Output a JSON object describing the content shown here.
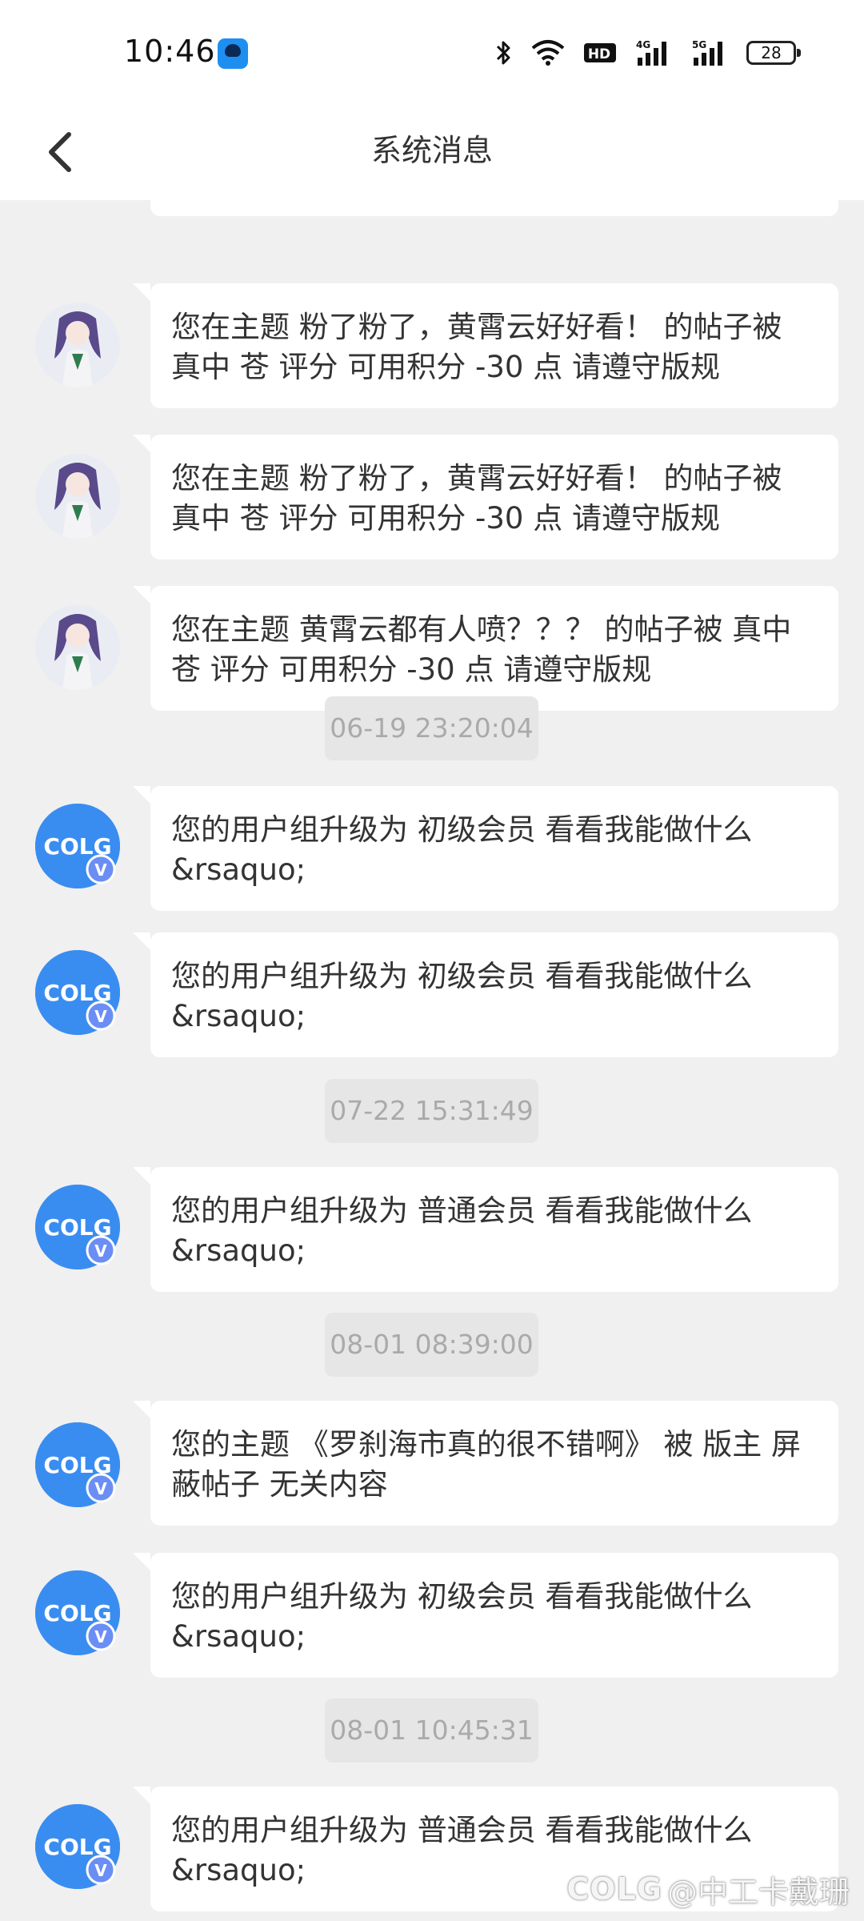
{
  "status_bar": {
    "time": "10:46",
    "battery": "28",
    "icons": [
      "app-icon",
      "bluetooth-icon",
      "wifi-icon",
      "hd-icon",
      "4g-signal-icon",
      "5g-signal-icon",
      "battery-icon"
    ]
  },
  "header": {
    "title": "系统消息",
    "back_icon": "chevron-left-icon"
  },
  "messages": [
    {
      "type": "message",
      "avatar": "anime-girl-avatar",
      "text": "您在主题 粉了粉了，黄霄云好好看！ 的帖子被 真中 苍 评分 可用积分 -30 点 请遵守版规"
    },
    {
      "type": "message",
      "avatar": "anime-girl-avatar",
      "text": "您在主题 粉了粉了，黄霄云好好看！ 的帖子被 真中 苍 评分 可用积分 -30 点 请遵守版规"
    },
    {
      "type": "message",
      "avatar": "anime-girl-avatar",
      "text": "您在主题 黄霄云都有人喷？？？ 的帖子被 真中 苍 评分 可用积分 -30 点 请遵守版规"
    },
    {
      "type": "timestamp",
      "text": "06-19 23:20:04"
    },
    {
      "type": "message",
      "avatar": "colg-avatar",
      "text": "您的用户组升级为 初级会员  看看我能做什么 &rsaquo;"
    },
    {
      "type": "message",
      "avatar": "colg-avatar",
      "text": "您的用户组升级为 初级会员  看看我能做什么 &rsaquo;"
    },
    {
      "type": "timestamp",
      "text": "07-22 15:31:49"
    },
    {
      "type": "message",
      "avatar": "colg-avatar",
      "text": "您的用户组升级为 普通会员  看看我能做什么 &rsaquo;"
    },
    {
      "type": "timestamp",
      "text": "08-01 08:39:00"
    },
    {
      "type": "message",
      "avatar": "colg-avatar",
      "text": "您的主题 《罗刹海市真的很不错啊》 被 版主 屏蔽帖子 无关内容"
    },
    {
      "type": "message",
      "avatar": "colg-avatar",
      "text": "您的用户组升级为 初级会员  看看我能做什么 &rsaquo;"
    },
    {
      "type": "timestamp",
      "text": "08-01 10:45:31"
    },
    {
      "type": "message",
      "avatar": "colg-avatar",
      "text": "您的用户组升级为 普通会员  看看我能做什么 &rsaquo;"
    }
  ],
  "watermark": {
    "logo": "COLG",
    "text": "@中工卡戴珊"
  }
}
